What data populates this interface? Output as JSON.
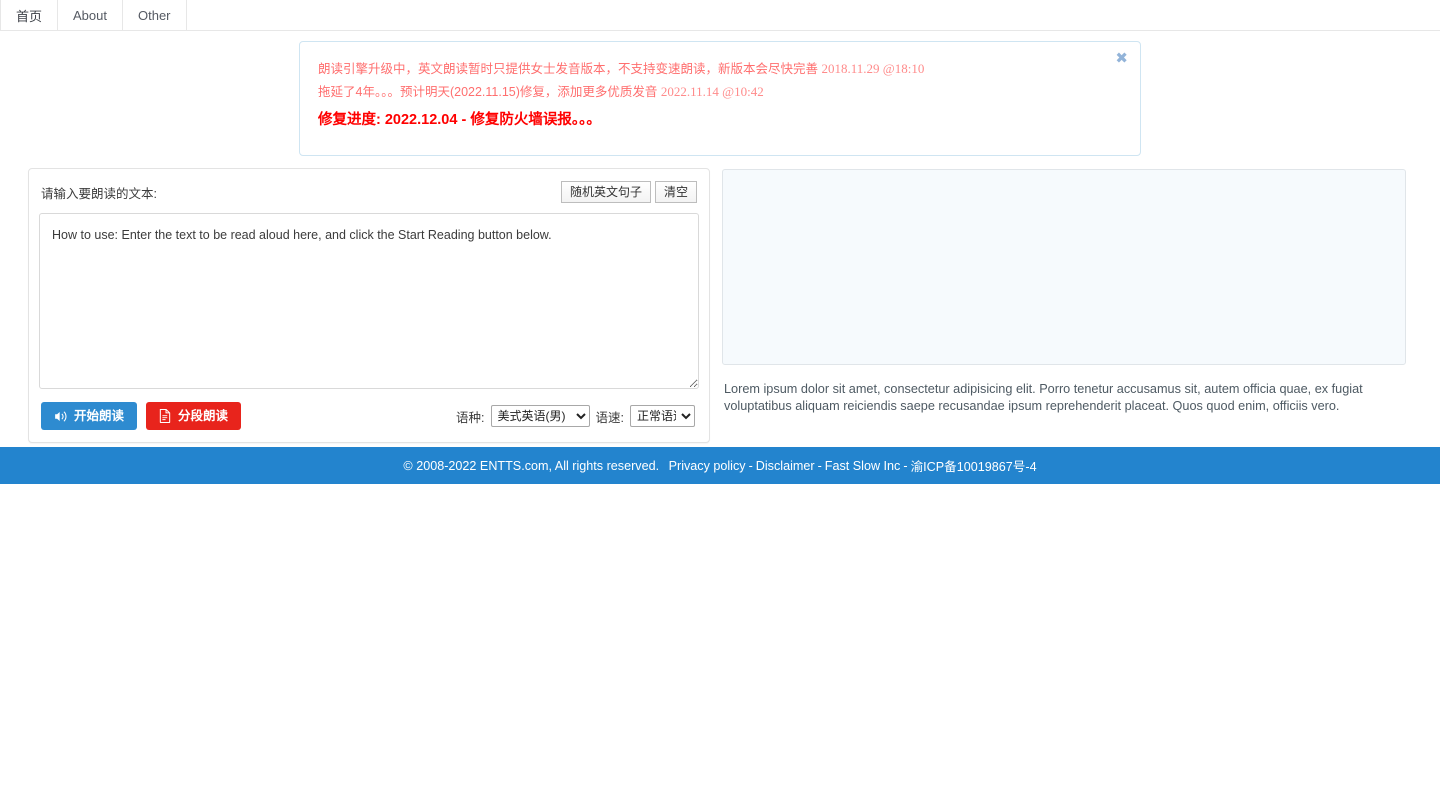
{
  "navbar": {
    "items": [
      {
        "label": "首页",
        "active": true
      },
      {
        "label": "About",
        "active": false
      },
      {
        "label": "Other",
        "active": false
      }
    ]
  },
  "alert": {
    "close_icon": "close-icon",
    "close_glyph": "✖",
    "lines": [
      {
        "text": "朗读引擎升级中，英文朗读暂时只提供女士发音版本，不支持变速朗读，新版本会尽快完善",
        "timestamp": "2018.11.29 @18:10",
        "emphasis": false
      },
      {
        "text": "拖延了4年。。。预计明天(2022.11.15)修复，添加更多优质发音",
        "timestamp": "2022.11.14 @10:42",
        "emphasis": false
      },
      {
        "text": "修复进度: 2022.12.04 - 修复防火墙误报。。。",
        "timestamp": "",
        "emphasis": true
      }
    ],
    "border_color": "#cfe5f2",
    "text_color": "#ff6f6f",
    "emphasis_color": "#ff0000"
  },
  "editor": {
    "label": "请输入要朗读的文本:",
    "random_button": "随机英文句子",
    "clear_button": "清空",
    "textarea_value": "How to use: Enter the text to be read aloud here, and click the Start Reading button below.",
    "textarea_placeholder": "请输入要朗读的文本",
    "start_button": "开始朗读",
    "start_icon": "volume-speaker-icon",
    "segment_button": "分段朗读",
    "segment_icon": "document-file-icon",
    "voice_label": "语种:",
    "voice_selected": "美式英语(男)",
    "voice_options": [
      "美式英语(男)"
    ],
    "speed_label": "语速:",
    "speed_selected": "正常语速",
    "speed_options": [
      "正常语速"
    ],
    "primary_color": "#2e8bd0",
    "danger_color": "#e8241c"
  },
  "preview": {
    "box_content": "",
    "caption": "Lorem ipsum dolor sit amet, consectetur adipisicing elit. Porro tenetur accusamus sit, autem officia quae, ex fugiat voluptatibus aliquam reiciendis saepe recusandae ipsum reprehenderit placeat. Quos quod enim, officiis vero."
  },
  "footer": {
    "copyright": "© 2008-2022 ENTTS.com, All rights reserved.",
    "links": [
      {
        "label": "Privacy policy"
      },
      {
        "label": "Disclaimer"
      },
      {
        "label": "Fast Slow Inc"
      },
      {
        "label": "渝ICP备10019867号-4"
      }
    ],
    "separator": "-",
    "background_color": "#2384ce"
  }
}
